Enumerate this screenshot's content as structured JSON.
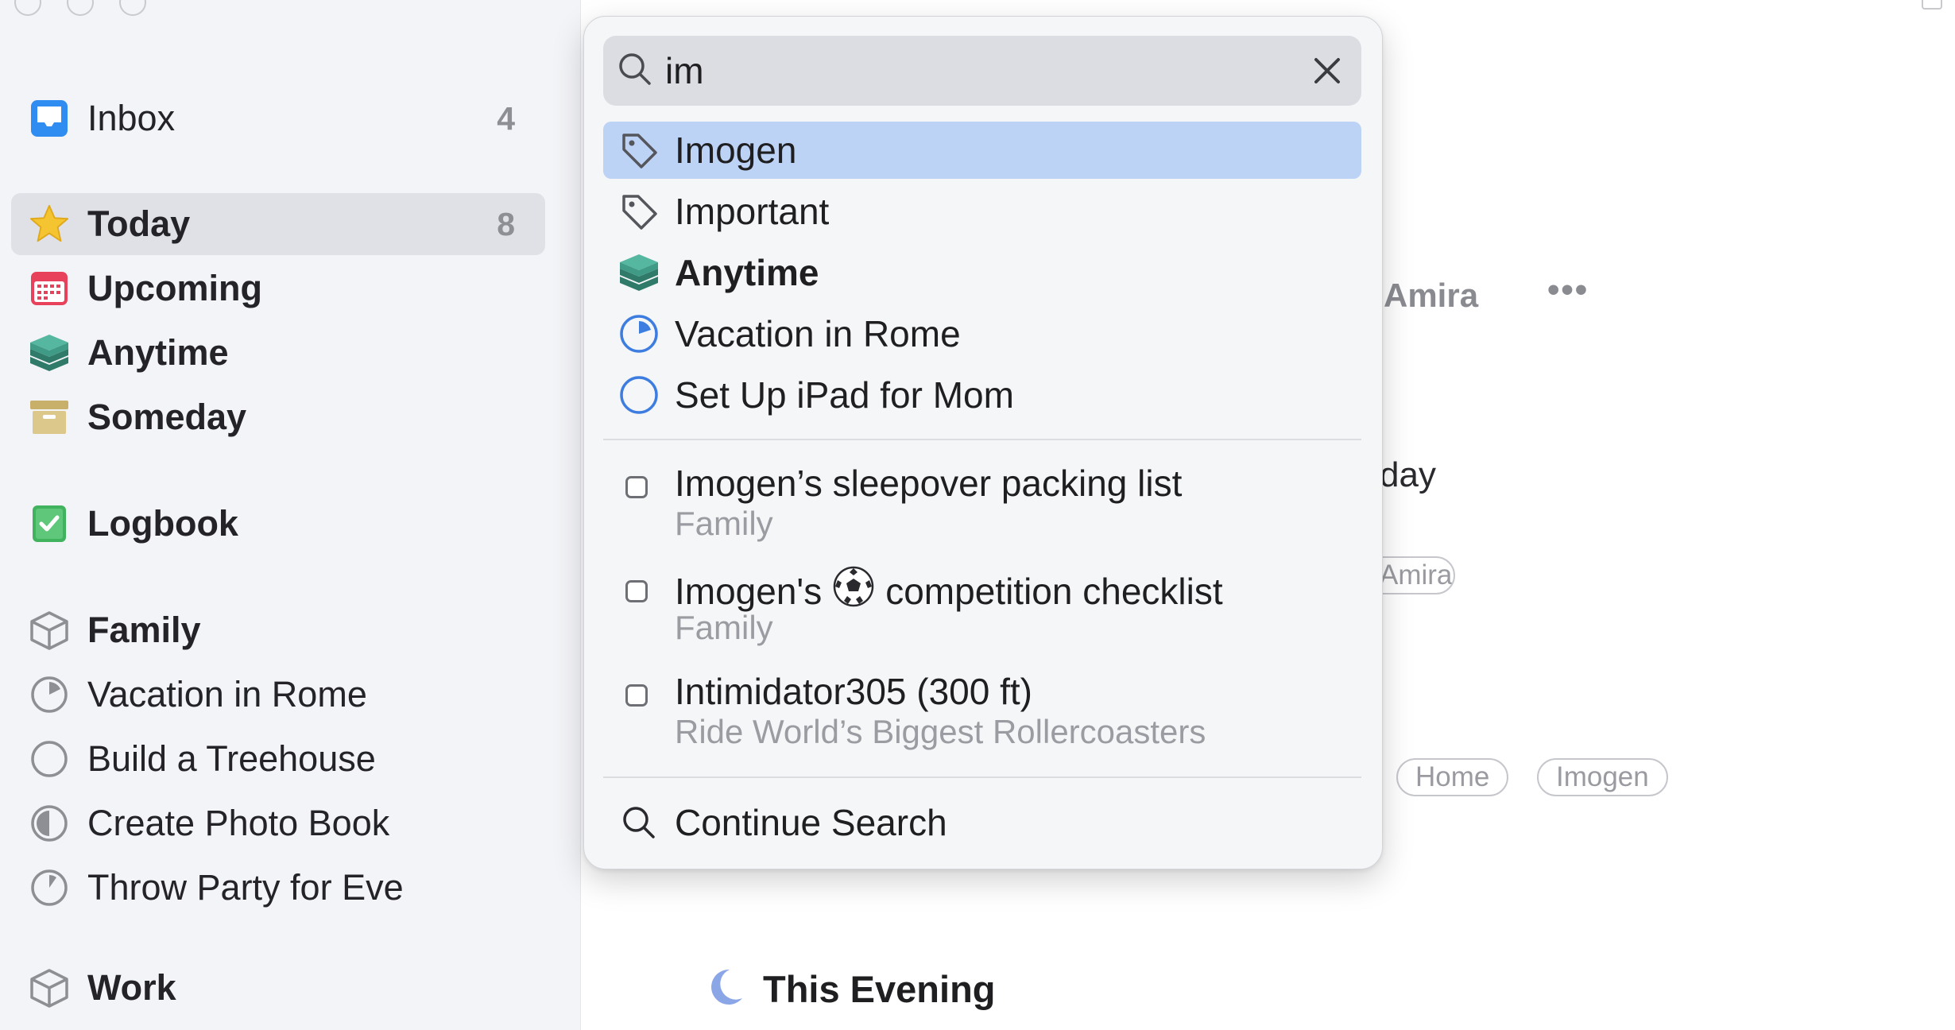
{
  "sidebar": {
    "inbox": {
      "label": "Inbox",
      "count": "4"
    },
    "today": {
      "label": "Today",
      "count": "8"
    },
    "upcoming": {
      "label": "Upcoming"
    },
    "anytime": {
      "label": "Anytime"
    },
    "someday": {
      "label": "Someday"
    },
    "logbook": {
      "label": "Logbook"
    },
    "areas": [
      {
        "label": "Family",
        "projects": [
          {
            "label": "Vacation in Rome"
          },
          {
            "label": "Build a Treehouse"
          },
          {
            "label": "Create Photo Book"
          },
          {
            "label": "Throw Party for Eve"
          }
        ]
      },
      {
        "label": "Work"
      }
    ]
  },
  "main": {
    "person_name": "Amira",
    "partial_heading": "day",
    "partial_tag": "Amira",
    "tags": [
      "Home",
      "Imogen"
    ],
    "evening_label": "This Evening"
  },
  "search": {
    "query": "im",
    "quick_results": [
      {
        "label": "Imogen",
        "kind": "tag"
      },
      {
        "label": "Important",
        "kind": "tag"
      },
      {
        "label": "Anytime",
        "kind": "list"
      },
      {
        "label": "Vacation in Rome",
        "kind": "project"
      },
      {
        "label": "Set Up iPad for Mom",
        "kind": "project"
      }
    ],
    "todos": [
      {
        "title": "Imogen’s sleepover packing list",
        "subtitle": "Family"
      },
      {
        "title_before": "Imogen's",
        "title_after": "competition checklist",
        "subtitle": "Family"
      },
      {
        "title": "Intimidator305 (300 ft)",
        "subtitle": "Ride World’s Biggest Rollercoasters"
      }
    ],
    "continue_label": "Continue Search"
  },
  "colors": {
    "highlight": "#bdd3f6",
    "inbox_blue": "#2f8cf0",
    "today_yellow": "#f5c531",
    "upcoming_red": "#e8415b",
    "anytime_teal": "#3f9a86",
    "someday_tan": "#d2bd7b",
    "logbook_green": "#41b35f",
    "project_blue": "#3e7de0"
  }
}
